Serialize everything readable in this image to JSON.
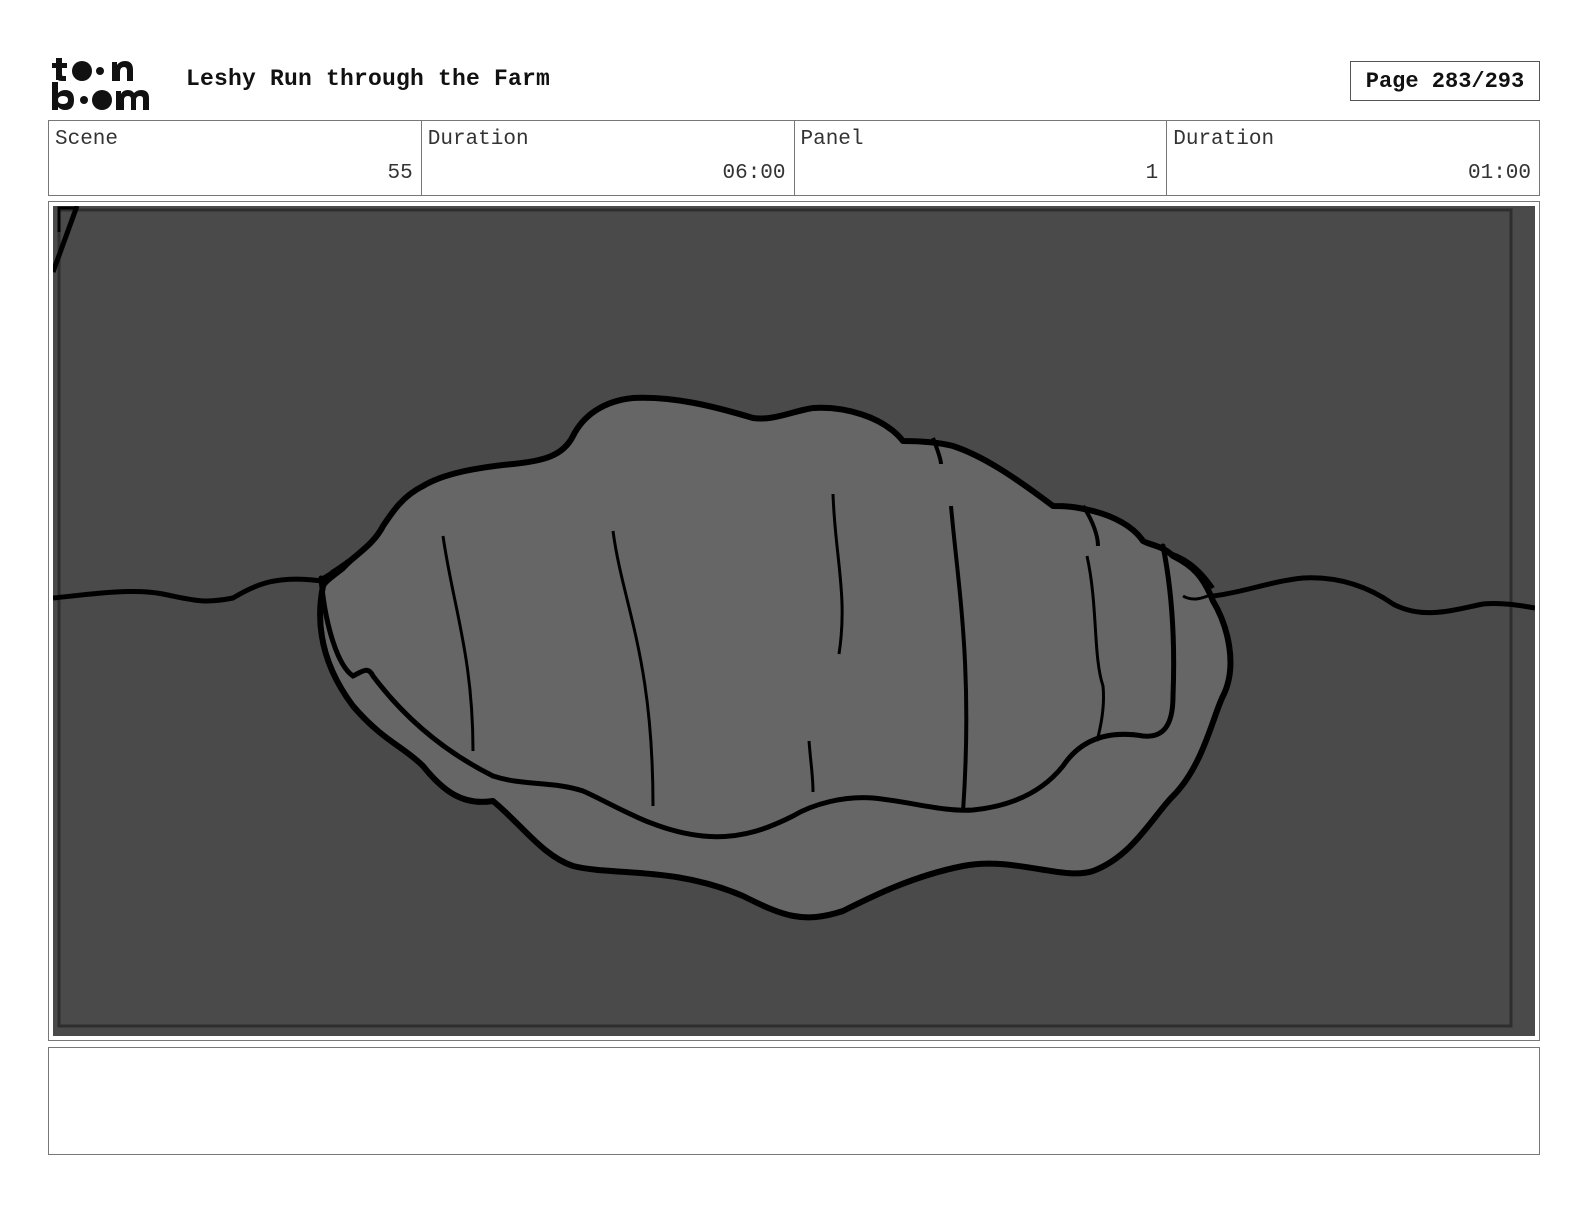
{
  "header": {
    "logo_icon": "toonboom-logo",
    "title": "Leshy Run through the Farm",
    "page": "Page 283/293"
  },
  "info": [
    {
      "label": "Scene",
      "value": "55"
    },
    {
      "label": "Duration",
      "value": "06:00"
    },
    {
      "label": "Panel",
      "value": "1"
    },
    {
      "label": "Duration",
      "value": "01:00"
    }
  ],
  "panel": {
    "background_color": "#4a4a4a",
    "shape_color": "#666666",
    "line_color": "#000000"
  },
  "notes": ""
}
